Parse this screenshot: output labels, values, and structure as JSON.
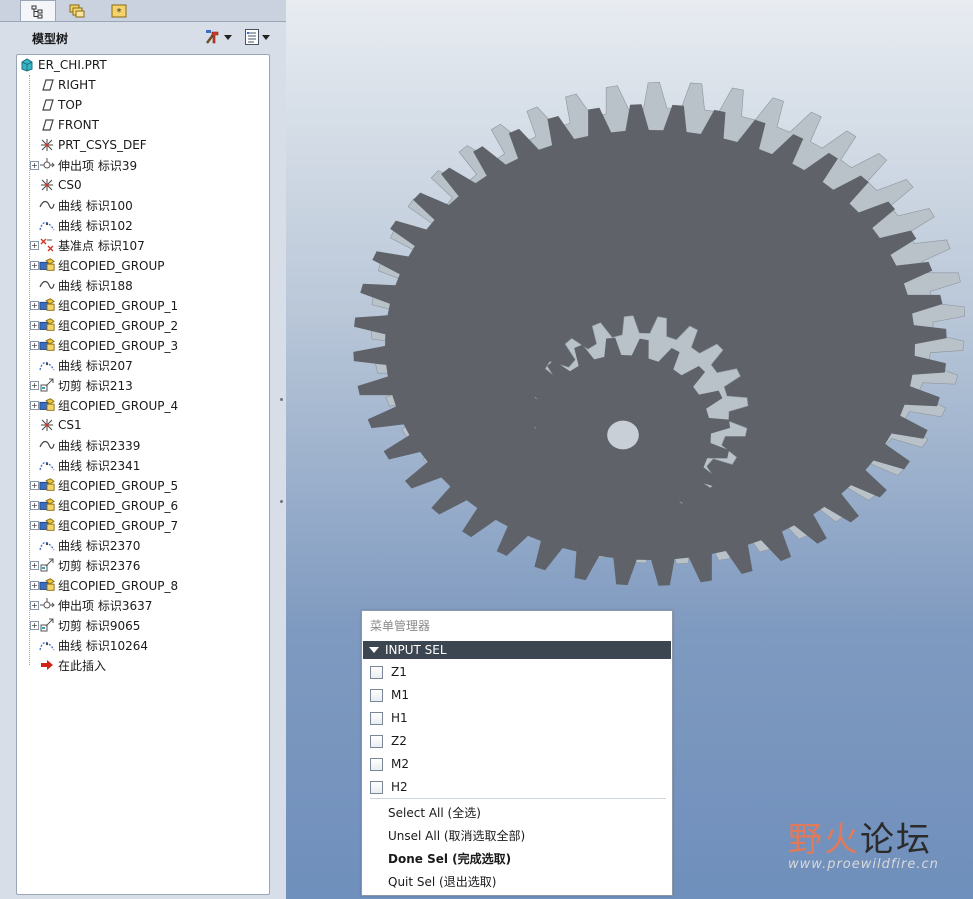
{
  "tabs": [
    {
      "icon": "model-tree-icon"
    },
    {
      "icon": "folder-browser-icon"
    },
    {
      "icon": "favorites-icon"
    }
  ],
  "tree": {
    "title": "模型树",
    "settings_icon": "tree-settings-icon",
    "show_icon": "tree-show-icon",
    "nodes": [
      {
        "label": "ER_CHI.PRT",
        "icon": "part-icon",
        "expandable": false,
        "root": true
      },
      {
        "label": "RIGHT",
        "icon": "datum-plane-icon",
        "expandable": false
      },
      {
        "label": "TOP",
        "icon": "datum-plane-icon",
        "expandable": false
      },
      {
        "label": "FRONT",
        "icon": "datum-plane-icon",
        "expandable": false
      },
      {
        "label": "PRT_CSYS_DEF",
        "icon": "csys-icon",
        "expandable": false
      },
      {
        "label": "伸出项 标识39",
        "icon": "protrusion-icon",
        "expandable": true
      },
      {
        "label": "CS0",
        "icon": "csys-icon",
        "expandable": false
      },
      {
        "label": "曲线 标识100",
        "icon": "curve-icon",
        "expandable": false
      },
      {
        "label": "曲线 标识102",
        "icon": "sketch-curve-icon",
        "expandable": false
      },
      {
        "label": "基准点 标识107",
        "icon": "datum-point-icon",
        "expandable": true
      },
      {
        "label": "组COPIED_GROUP",
        "icon": "group-icon",
        "expandable": true
      },
      {
        "label": "曲线 标识188",
        "icon": "curve-icon",
        "expandable": false
      },
      {
        "label": "组COPIED_GROUP_1",
        "icon": "group-icon",
        "expandable": true
      },
      {
        "label": "组COPIED_GROUP_2",
        "icon": "group-icon",
        "expandable": true
      },
      {
        "label": "组COPIED_GROUP_3",
        "icon": "group-icon",
        "expandable": true
      },
      {
        "label": "曲线 标识207",
        "icon": "sketch-curve-icon",
        "expandable": false
      },
      {
        "label": "切剪 标识213",
        "icon": "cut-icon",
        "expandable": true
      },
      {
        "label": "组COPIED_GROUP_4",
        "icon": "group-icon",
        "expandable": true
      },
      {
        "label": "CS1",
        "icon": "csys-icon",
        "expandable": false
      },
      {
        "label": "曲线 标识2339",
        "icon": "curve-icon",
        "expandable": false
      },
      {
        "label": "曲线 标识2341",
        "icon": "sketch-curve-icon",
        "expandable": false
      },
      {
        "label": "组COPIED_GROUP_5",
        "icon": "group-icon",
        "expandable": true
      },
      {
        "label": "组COPIED_GROUP_6",
        "icon": "group-icon",
        "expandable": true
      },
      {
        "label": "组COPIED_GROUP_7",
        "icon": "group-icon",
        "expandable": true
      },
      {
        "label": "曲线 标识2370",
        "icon": "sketch-curve-icon",
        "expandable": false
      },
      {
        "label": "切剪 标识2376",
        "icon": "cut-icon",
        "expandable": true
      },
      {
        "label": "组COPIED_GROUP_8",
        "icon": "group-icon",
        "expandable": true
      },
      {
        "label": "伸出项 标识3637",
        "icon": "protrusion-icon",
        "expandable": true
      },
      {
        "label": "切剪 标识9065",
        "icon": "cut-icon",
        "expandable": true
      },
      {
        "label": "曲线 标识10264",
        "icon": "sketch-curve-icon",
        "expandable": false
      },
      {
        "label": "在此插入",
        "icon": "insert-here-icon",
        "expandable": false
      }
    ]
  },
  "menu": {
    "title": "菜单管理器",
    "submenu": "INPUT SEL",
    "checkboxes": [
      {
        "label": "Z1",
        "checked": false
      },
      {
        "label": "M1",
        "checked": false
      },
      {
        "label": "H1",
        "checked": false
      },
      {
        "label": "Z2",
        "checked": false
      },
      {
        "label": "M2",
        "checked": false
      },
      {
        "label": "H2",
        "checked": false
      }
    ],
    "actions": [
      {
        "label": "Select All (全选)",
        "bold": false
      },
      {
        "label": "Unsel All (取消选取全部)",
        "bold": false
      },
      {
        "label": "Done Sel (完成选取)",
        "bold": true
      },
      {
        "label": "Quit Sel (退出选取)",
        "bold": false
      }
    ]
  },
  "watermark": {
    "text_accent": "野火",
    "text_dark": "论坛",
    "url": "www.proewildfire.cn"
  },
  "colors": {
    "gear": "#5f6369",
    "gear_tooth": "#b9c1c9",
    "menu_header": "#3c4650"
  }
}
